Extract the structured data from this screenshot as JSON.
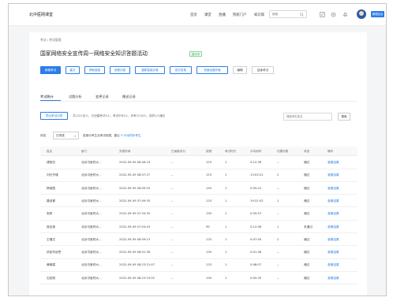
{
  "app": {
    "brand": "北中医网课堂",
    "nav": [
      "首页",
      "课堂",
      "直播",
      "院校门户",
      "知识库"
    ],
    "search_placeholder": "搜索",
    "manage_button": "管理后台"
  },
  "breadcrumb": "考试 / 考试管理",
  "page_title": "国家网络安全宣传周—网络安全知识答题活动",
  "status_badge": "进行中",
  "actions": [
    "新建考试",
    "催交",
    "获取链接",
    "查看试卷",
    "重新智能办卷",
    "批次答卷",
    "快速创建作卷",
    "编辑",
    "结束考试"
  ],
  "tabs": [
    "考试统计",
    "试题分析",
    "变更记录",
    "播送记录"
  ],
  "toolbar": {
    "export_label": "导出考试记录",
    "stats_text": "共1221名人，已创建考试0人，考试中63人，未考1218人，放弃1人通过",
    "search_placeholder": "搜索考生姓名",
    "search_button": "搜索"
  },
  "filter": {
    "label": "状态",
    "value": "已完成",
    "hint": "若部分考生无考试权限，建议",
    "hint_link": "手动同步考生"
  },
  "table": {
    "headers": [
      "姓名",
      "部门",
      "完成时间",
      "已阅卷评分",
      "成绩",
      "考试时长",
      "平均用时",
      "切屏次数",
      "状态",
      "操作"
    ],
    "rows": [
      [
        "谭俊凯",
        "北京中医药大...",
        "2022-09-09 06:46:19",
        "--",
        "125",
        "1",
        "0:12:36",
        "--",
        "通过",
        "查看结果"
      ],
      [
        "刘兄卉瑾",
        "北京中医药大...",
        "2022-09-09 06:07:27",
        "--",
        "125",
        "1",
        "13:03:21",
        "2",
        "通过",
        "查看结果"
      ],
      [
        "杨瑞霞",
        "北京中医药大...",
        "2022-09-09 06:09:25",
        "--",
        "145",
        "1",
        "0:05:41",
        "--",
        "通过",
        "查看结果"
      ],
      [
        "康淑景",
        "北京中医药大...",
        "2022-09-09 07:49:35",
        "--",
        "125",
        "1",
        "19:22:42",
        "1",
        "通过",
        "查看结果"
      ],
      [
        "张妍",
        "北京中医药大...",
        "2022-09-09 07:34:35",
        "--",
        "150",
        "1",
        "0:05:57",
        "--",
        "通过",
        "查看结果"
      ],
      [
        "庞佳惠",
        "北京中医药大...",
        "2022-09-09 07:04:43",
        "--",
        "95",
        "1",
        "0:12:08",
        "1",
        "未通过",
        "查看结果"
      ],
      [
        "王璐文",
        "北京中医药大...",
        "2022-09-09 06:59:13",
        "--",
        "125",
        "1",
        "0:07:50",
        "2",
        "通过",
        "查看结果"
      ],
      [
        "热依罕武思",
        "北京中医药大...",
        "2022-09-09 06:01:38",
        "--",
        "150",
        "1",
        "0:01:46",
        "--",
        "通过",
        "查看结果"
      ],
      [
        "黄晒霖",
        "北京中医药大...",
        "2022-09-09 08:23:21:47",
        "--",
        "125",
        "1",
        "0:08:07",
        "--",
        "通过",
        "查看结果"
      ],
      [
        "石蕊丽",
        "北京中医药大...",
        "2022-09-09 08:23:15:52",
        "--",
        "150",
        "1",
        "0:05:35",
        "--",
        "通过",
        "查看结果"
      ]
    ]
  }
}
